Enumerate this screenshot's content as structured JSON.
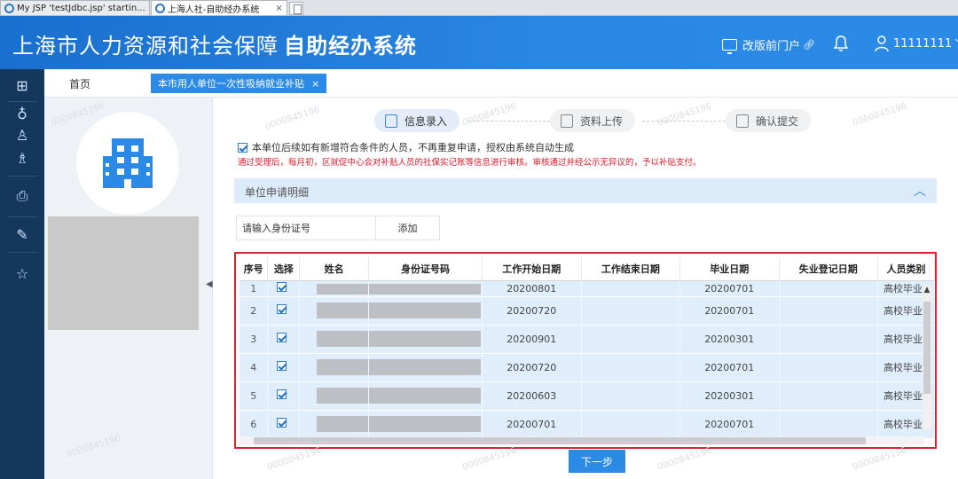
{
  "browser": {
    "tabs": [
      {
        "title": "My JSP 'testJdbc.jsp' startin...",
        "active": false
      },
      {
        "title": "上海人社-自助经办系统",
        "active": true,
        "close": "×"
      }
    ]
  },
  "header": {
    "title_main": "上海市人力资源和社会保障",
    "title_strong": "自助经办系统",
    "link_label": "改版前门户",
    "username": "11111111",
    "brand_color": "#2a8ae6"
  },
  "rail": {
    "icons": [
      "apps-icon",
      "award-icon",
      "user-badge-icon",
      "users-icon",
      "printer-icon",
      "edit-doc-icon",
      "star-icon"
    ]
  },
  "nav": {
    "home": "首页",
    "active_tab": "本市用人单位一次性吸纳就业补贴",
    "close": "×"
  },
  "watermark": "0000845196",
  "steps": [
    {
      "label": "信息录入",
      "state": "current"
    },
    {
      "label": "资料上传",
      "state": "pending"
    },
    {
      "label": "确认提交",
      "state": "pending"
    }
  ],
  "notice": {
    "text": "本单位后续如有新增符合条件的人员，不再重复申请，授权由系统自动生成",
    "checked": true,
    "red": "通过受理后，每月初，区就促中心会对补贴人员的社保实记账等信息进行审核。审核通过并经公示无异议的，予以补贴支付。"
  },
  "section": {
    "title": "单位申请明细",
    "chevron": "︿"
  },
  "id_input": {
    "placeholder": "请输入身份证号",
    "add_label": "添加"
  },
  "table": {
    "columns": [
      "序号",
      "选择",
      "姓名",
      "身份证号码",
      "工作开始日期",
      "工作结束日期",
      "毕业日期",
      "失业登记日期",
      "人员类别"
    ],
    "rows": [
      {
        "idx": "1",
        "start": "20200801",
        "end": "",
        "grad": "20200701",
        "unemp": "",
        "cat": "高校毕业"
      },
      {
        "idx": "2",
        "start": "20200720",
        "end": "",
        "grad": "20200701",
        "unemp": "",
        "cat": "高校毕业"
      },
      {
        "idx": "3",
        "start": "20200901",
        "end": "",
        "grad": "20200301",
        "unemp": "",
        "cat": "高校毕业"
      },
      {
        "idx": "4",
        "start": "20200720",
        "end": "",
        "grad": "20200701",
        "unemp": "",
        "cat": "高校毕业"
      },
      {
        "idx": "5",
        "start": "20200603",
        "end": "",
        "grad": "20200301",
        "unemp": "",
        "cat": "高校毕业"
      },
      {
        "idx": "6",
        "start": "20200701",
        "end": "",
        "grad": "20200701",
        "unemp": "",
        "cat": "高校毕业"
      }
    ]
  },
  "next_label": "下一步"
}
